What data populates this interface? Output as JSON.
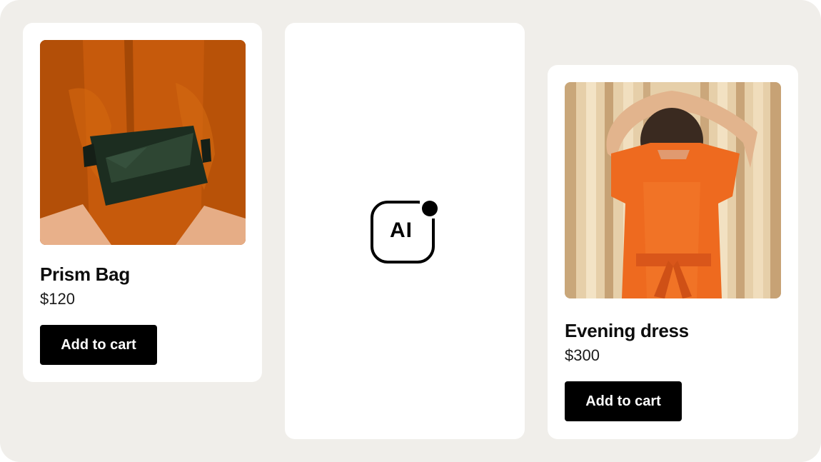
{
  "products": [
    {
      "name": "Prism Bag",
      "price": "$120",
      "button_label": "Add to cart",
      "image": "woman-orange-jacket-green-belt-bag"
    },
    {
      "name": "Evening dress",
      "price": "$300",
      "button_label": "Add to cart",
      "image": "woman-orange-dress-curtain-background"
    }
  ],
  "ai_badge": {
    "label": "AI",
    "icon": "ai-sparkle-icon"
  },
  "colors": {
    "background": "#f0eeea",
    "card": "#ffffff",
    "button": "#000000",
    "button_text": "#ffffff"
  }
}
